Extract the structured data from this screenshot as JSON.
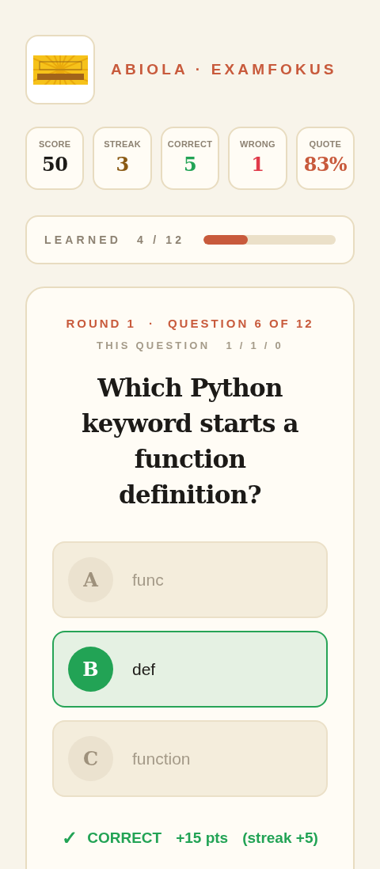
{
  "header": {
    "title": "ABIOLA · EXAMFOKUS"
  },
  "stats": [
    {
      "label": "SCORE",
      "value": "50",
      "color": "#1c1a17"
    },
    {
      "label": "STREAK",
      "value": "3",
      "color": "#8a5a14"
    },
    {
      "label": "CORRECT",
      "value": "5",
      "color": "#22a355"
    },
    {
      "label": "WRONG",
      "value": "1",
      "color": "#e03a4a"
    },
    {
      "label": "QUOTE",
      "value": "83%",
      "color": "#c85a3c"
    }
  ],
  "progress": {
    "label": "LEARNED",
    "count": "4 / 12",
    "level": 0.333
  },
  "question": {
    "round": "ROUND 1",
    "separator": "·",
    "position": "QUESTION 6 OF 12",
    "tally_label": "THIS QUESTION",
    "tally": "1 / 1 / 0",
    "text": "Which Python keyword starts a function definition?",
    "options": [
      {
        "letter": "A",
        "text": "func",
        "selected": false
      },
      {
        "letter": "B",
        "text": "def",
        "selected": true
      },
      {
        "letter": "C",
        "text": "function",
        "selected": false
      }
    ],
    "feedback": {
      "mark": "✓",
      "verdict": "CORRECT",
      "points": "+15 pts",
      "streak": "(streak +5)",
      "correct": true
    }
  }
}
